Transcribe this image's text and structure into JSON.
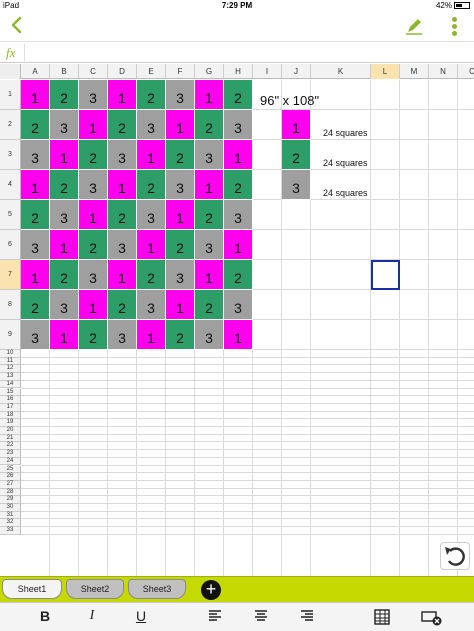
{
  "status_bar": {
    "device": "iPad",
    "time": "7:29 PM",
    "battery": "42%"
  },
  "formula_bar": {
    "fx_label": "fx",
    "value": ""
  },
  "columns": [
    "A",
    "B",
    "C",
    "D",
    "E",
    "F",
    "G",
    "H",
    "I",
    "J",
    "K",
    "L",
    "M",
    "N",
    "C"
  ],
  "active_column": "L",
  "rows": [
    "1",
    "2",
    "3",
    "4",
    "5",
    "6",
    "7",
    "8",
    "9",
    "10",
    "11",
    "12",
    "13",
    "14",
    "15",
    "16",
    "17",
    "18",
    "19",
    "20",
    "21",
    "22",
    "23",
    "24",
    "25",
    "26",
    "27",
    "28",
    "29",
    "30",
    "31",
    "32",
    "33"
  ],
  "active_row": "7",
  "colors": {
    "1": "#ff00ee",
    "2": "#2e9e68",
    "3": "#9f9f9f",
    "accent": "#8bb82a",
    "tabbar": "#c3d900",
    "selection": "#1a2fa0"
  },
  "quilt": [
    [
      "1",
      "2",
      "3",
      "1",
      "2",
      "3",
      "1",
      "2"
    ],
    [
      "2",
      "3",
      "1",
      "2",
      "3",
      "1",
      "2",
      "3"
    ],
    [
      "3",
      "1",
      "2",
      "3",
      "1",
      "2",
      "3",
      "1"
    ],
    [
      "1",
      "2",
      "3",
      "1",
      "2",
      "3",
      "1",
      "2"
    ],
    [
      "2",
      "3",
      "1",
      "2",
      "3",
      "1",
      "2",
      "3"
    ],
    [
      "3",
      "1",
      "2",
      "3",
      "1",
      "2",
      "3",
      "1"
    ],
    [
      "1",
      "2",
      "3",
      "1",
      "2",
      "3",
      "1",
      "2"
    ],
    [
      "2",
      "3",
      "1",
      "2",
      "3",
      "1",
      "2",
      "3"
    ],
    [
      "3",
      "1",
      "2",
      "3",
      "1",
      "2",
      "3",
      "1"
    ]
  ],
  "legend": {
    "size_label": "96\" x 108\"",
    "items": [
      {
        "value": "1",
        "count": "24 squares"
      },
      {
        "value": "2",
        "count": "24 squares"
      },
      {
        "value": "3",
        "count": "24 squares"
      }
    ]
  },
  "sheets": [
    {
      "name": "Sheet1",
      "active": true
    },
    {
      "name": "Sheet2",
      "active": false
    },
    {
      "name": "Sheet3",
      "active": false
    }
  ],
  "add_sheet_label": "+",
  "format_bar": {
    "bold": "B",
    "italic": "I",
    "underline": "U"
  },
  "icons": [
    "chevron-left-icon",
    "pen-icon",
    "more-icon",
    "undo-icon",
    "align-left-icon",
    "align-center-icon",
    "align-right-icon",
    "table-icon",
    "delete-cell-icon"
  ]
}
